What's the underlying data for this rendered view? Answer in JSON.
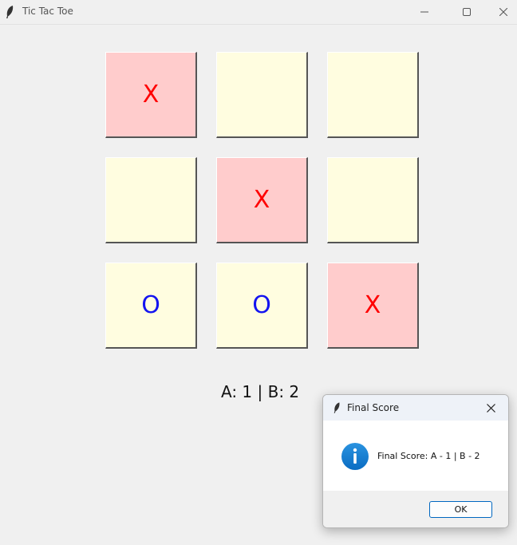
{
  "window": {
    "title": "Tic Tac Toe",
    "icon": "feather-icon",
    "controls": [
      "minimize-icon",
      "maximize-icon",
      "close-icon"
    ]
  },
  "board": {
    "cells": [
      {
        "mark": "X",
        "state": "marked"
      },
      {
        "mark": "",
        "state": "empty"
      },
      {
        "mark": "",
        "state": "empty"
      },
      {
        "mark": "",
        "state": "empty"
      },
      {
        "mark": "X",
        "state": "marked"
      },
      {
        "mark": "",
        "state": "empty"
      },
      {
        "mark": "O",
        "state": "empty"
      },
      {
        "mark": "O",
        "state": "empty"
      },
      {
        "mark": "X",
        "state": "marked"
      }
    ]
  },
  "score": {
    "text": "A: 1 | B: 2"
  },
  "dialog": {
    "title": "Final Score",
    "icon": "info-icon",
    "message": "Final Score: A - 1 | B - 2",
    "ok_label": "OK"
  },
  "colors": {
    "cell_empty": "#fffde0",
    "cell_marked": "#ffcccc",
    "x_color": "#ff0000",
    "o_color": "#1414f0",
    "accent": "#0067c0"
  }
}
